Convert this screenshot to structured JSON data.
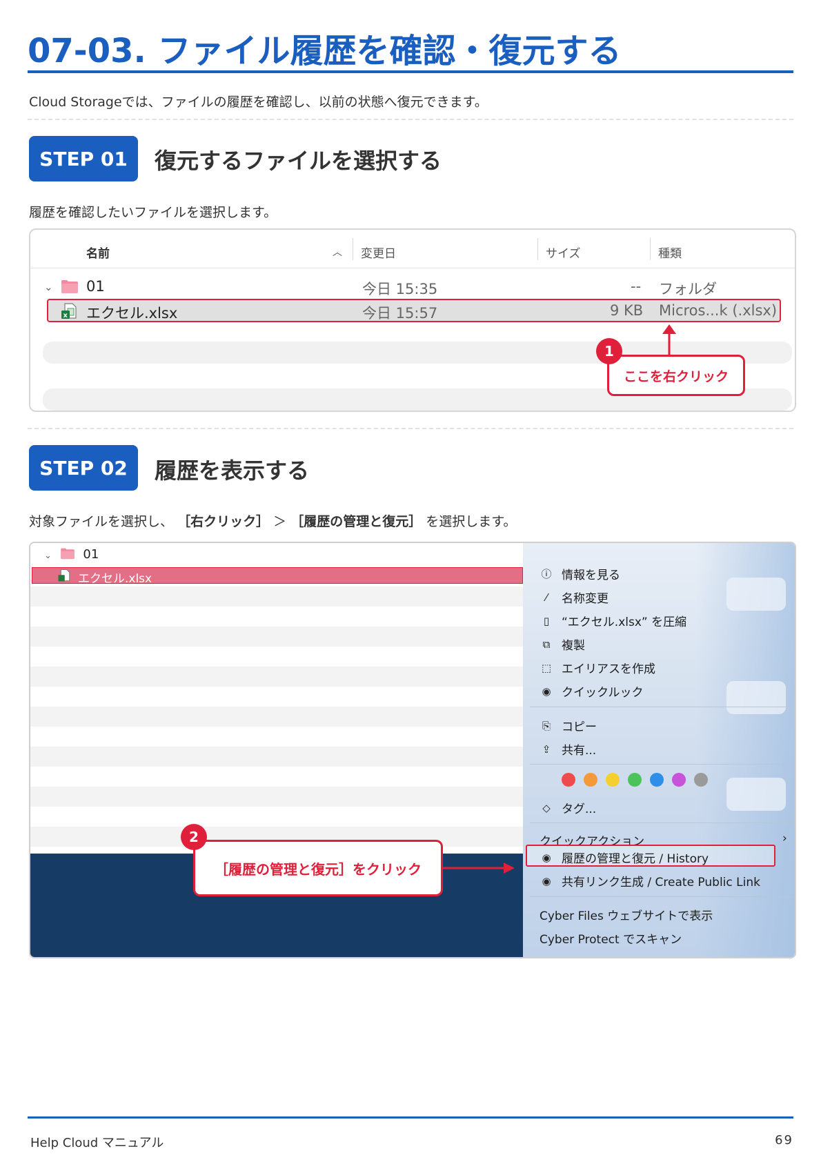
{
  "page": {
    "title": "07-03. ファイル履歴を確認・復元する",
    "intro": "Cloud Storageでは、ファイルの履歴を確認し、以前の状態へ復元できます。"
  },
  "step1": {
    "badge": "STEP 01",
    "title": "復元するファイルを選択する",
    "description": "履歴を確認したいファイルを選択します。",
    "columns": [
      "名前",
      "変更日",
      "サイズ",
      "種類"
    ],
    "rows": [
      {
        "name": "01",
        "date": "今日 15:35",
        "size": "--",
        "kind": "フォルダ"
      },
      {
        "name": "エクセル.xlsx",
        "date": "今日 15:57",
        "size": "9 KB",
        "kind": "Micros...k (.xlsx)"
      }
    ],
    "callout_number": "1",
    "callout_text": "ここを右クリック"
  },
  "step2": {
    "badge": "STEP 02",
    "title": "履歴を表示する",
    "description_pre": "対象ファイルを選択し、",
    "description_b1": "［右クリック］",
    "description_sep": "＞",
    "description_b2": "［履歴の管理と復元］",
    "description_post": "を選択します。",
    "folder": "01",
    "file": "エクセル.xlsx",
    "menu_items": [
      {
        "icon": "info-icon",
        "label": "情報を見る"
      },
      {
        "icon": "pencil-icon",
        "label": "名称変更"
      },
      {
        "icon": "archive-icon",
        "label": "“エクセル.xlsx” を圧縮"
      },
      {
        "icon": "duplicate-icon",
        "label": "複製"
      },
      {
        "icon": "alias-icon",
        "label": "エイリアスを作成"
      },
      {
        "icon": "eye-icon",
        "label": "クイックルック"
      },
      {
        "icon": "copy-icon",
        "label": "コピー"
      },
      {
        "icon": "share-icon",
        "label": "共有..."
      },
      {
        "icon": "tag-icon",
        "label": "タグ..."
      },
      {
        "icon": "",
        "label": "クイックアクション"
      },
      {
        "icon": "history-icon",
        "label": "履歴の管理と復元 / History"
      },
      {
        "icon": "link-icon",
        "label": "共有リンク生成 / Create Public Link"
      },
      {
        "icon": "",
        "label": "Cyber Files ウェブサイトで表示"
      },
      {
        "icon": "",
        "label": "Cyber Protect でスキャン"
      }
    ],
    "tag_colors": [
      "#ee4c4c",
      "#f49a3a",
      "#f5cf2f",
      "#4cc35a",
      "#2f8fe8",
      "#c653d9",
      "#9a9a9a"
    ],
    "callout_number": "2",
    "callout_text": "［履歴の管理と復元］をクリック"
  },
  "footer": {
    "left": "Help Cloud マニュアル",
    "page_number": "69"
  }
}
